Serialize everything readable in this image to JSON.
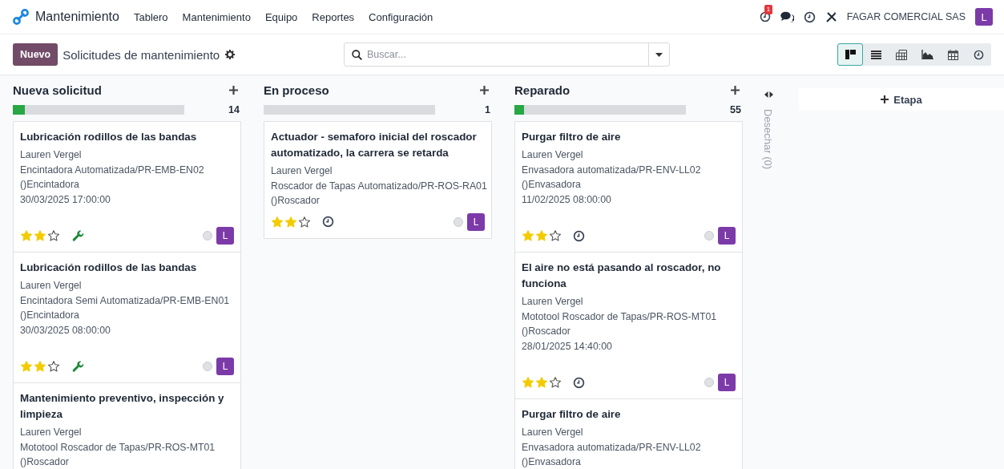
{
  "navbar": {
    "app_name": "Mantenimiento",
    "menu": [
      "Tablero",
      "Mantenimiento",
      "Equipo",
      "Reportes",
      "Configuración"
    ],
    "activity_badge": "1",
    "company": "FAGAR COMERCIAL SAS",
    "avatar": "L"
  },
  "control_panel": {
    "new_button": "Nuevo",
    "title": "Solicitudes de mantenimiento",
    "search": {
      "placeholder": "Buscar..."
    },
    "views": [
      {
        "kind": "kanban",
        "selected": true
      },
      {
        "kind": "list",
        "selected": false
      },
      {
        "kind": "pivot",
        "selected": false
      },
      {
        "kind": "graph",
        "selected": false
      },
      {
        "kind": "calendar",
        "selected": false
      },
      {
        "kind": "activity",
        "selected": false
      }
    ]
  },
  "columns": [
    {
      "title": "Nueva solicitud",
      "level": 0.07,
      "count": "14",
      "cards": [
        {
          "title": "Lubricación rodillos de las bandas",
          "user": "Lauren Vergel",
          "equipment": "Encintadora Automatizada/PR-EMB-EN02",
          "category": "()Encintadora",
          "date": "30/03/2025 17:00:00",
          "stars": 2,
          "kind": "wrench",
          "avatar": "L"
        },
        {
          "title": "Lubricación rodillos de las bandas",
          "user": "Lauren Vergel",
          "equipment": "Encintadora Semi Automatizada/PR-EMB-EN01",
          "category": "()Encintadora",
          "date": "30/03/2025 08:00:00",
          "stars": 2,
          "kind": "wrench",
          "avatar": "L"
        },
        {
          "title": "Mantenimiento preventivo, inspección y limpieza",
          "user": "Lauren Vergel",
          "equipment": "Mototool Roscador de Tapas/PR-ROS-MT01",
          "category": "()Roscador"
        }
      ]
    },
    {
      "title": "En proceso",
      "level": 0,
      "count": "1",
      "cards": [
        {
          "title": "Actuador - semaforo inicial del roscador automatizado, la carrera se retarda",
          "user": "Lauren Vergel",
          "equipment": "Roscador de Tapas Automatizado/PR-ROS-RA01",
          "category": "()Roscador",
          "stars": 2,
          "kind": "clock",
          "avatar": "L"
        }
      ]
    },
    {
      "title": "Reparado",
      "level": 0.055,
      "count": "55",
      "cards": [
        {
          "title": "Purgar filtro de aire",
          "user": "Lauren Vergel",
          "equipment": "Envasadora automatizada/PR-ENV-LL02",
          "category": "()Envasadora",
          "date": "11/02/2025 08:00:00",
          "stars": 2,
          "kind": "clock",
          "avatar": "L"
        },
        {
          "title": "El aire no está pasando al roscador, no funciona",
          "user": "Lauren Vergel",
          "equipment": "Mototool Roscador de Tapas/PR-ROS-MT01",
          "category": "()Roscador",
          "date": "28/01/2025 14:40:00",
          "stars": 2,
          "kind": "clock",
          "avatar": "L"
        },
        {
          "title": "Purgar filtro de aire",
          "user": "Lauren Vergel",
          "equipment": "Envasadora automatizada/PR-ENV-LL02",
          "category": "()Envasadora"
        }
      ]
    }
  ],
  "folded_column": {
    "title": "Desechar (0)"
  },
  "add_stage": "Etapa"
}
